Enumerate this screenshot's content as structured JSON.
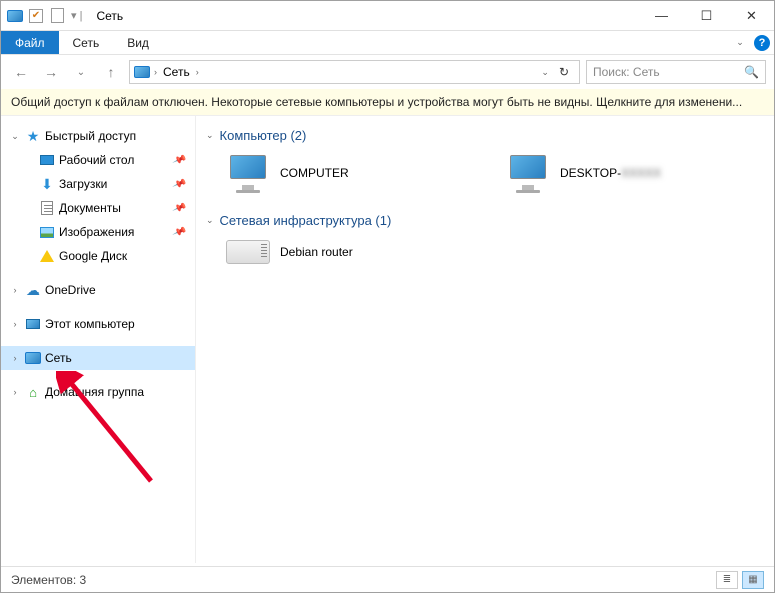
{
  "title": "Сеть",
  "ribbon": {
    "file": "Файл",
    "tab_network": "Сеть",
    "tab_view": "Вид"
  },
  "breadcrumb": {
    "root": "Сеть"
  },
  "search_placeholder": "Поиск: Сеть",
  "warning": "Общий доступ к файлам отключен. Некоторые сетевые компьютеры и устройства могут быть не видны. Щелкните для изменени...",
  "sidebar": {
    "quick": "Быстрый доступ",
    "desktop": "Рабочий стол",
    "downloads": "Загрузки",
    "documents": "Документы",
    "pictures": "Изображения",
    "gdrive": "Google Диск",
    "onedrive": "OneDrive",
    "thispc": "Этот компьютер",
    "network": "Сеть",
    "homegroup": "Домашняя группа"
  },
  "groups": {
    "computers_label": "Компьютер (2)",
    "infra_label": "Сетевая инфраструктура (1)"
  },
  "items": {
    "comp1": "COMPUTER",
    "comp2_prefix": "DESKTOP-",
    "comp2_suffix": "XXXXX",
    "router": "Debian router"
  },
  "status": "Элементов: 3"
}
